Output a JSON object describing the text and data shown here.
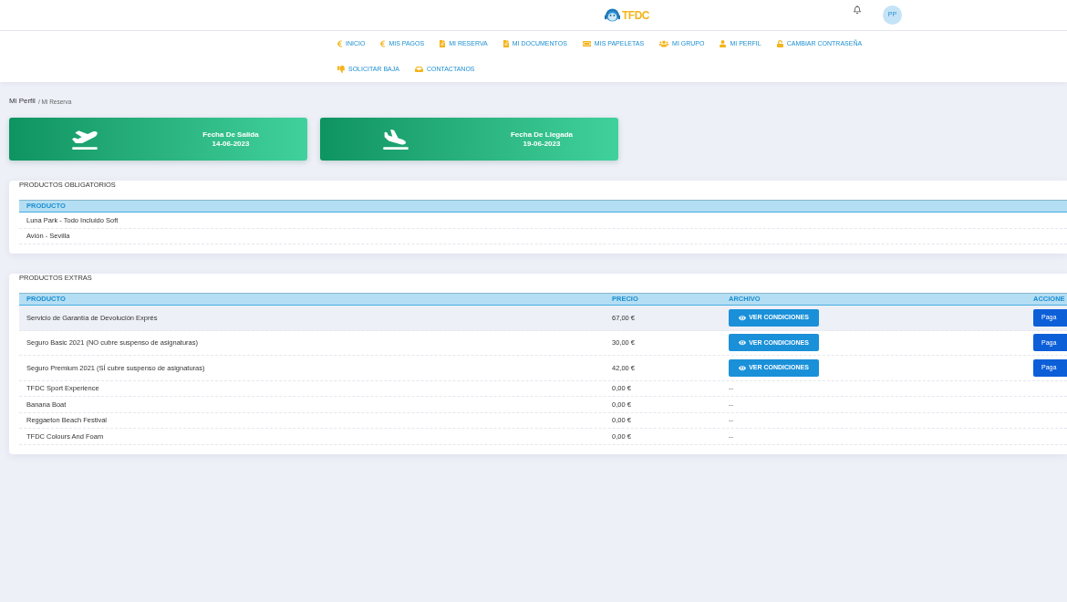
{
  "header": {
    "logo_text": "TFDC",
    "avatar_initials": "PP"
  },
  "nav": {
    "items": [
      {
        "label": "INICIO"
      },
      {
        "label": "MIS PAGOS"
      },
      {
        "label": "MI RESERVA"
      },
      {
        "label": "MI DOCUMENTOS"
      },
      {
        "label": "MIS PAPELETAS"
      },
      {
        "label": "MI GRUPO"
      },
      {
        "label": "MI PERFIL"
      },
      {
        "label": "CAMBIAR CONTRASEÑA"
      },
      {
        "label": "SOLICITAR BAJA"
      },
      {
        "label": "CONTACTANOS"
      }
    ]
  },
  "breadcrumb": {
    "parent": "Mi Perfil",
    "current": "/ Mi Reserva"
  },
  "date_cards": [
    {
      "kind": "departure",
      "label": "Fecha De Salida",
      "date": "14-06-2023"
    },
    {
      "kind": "arrival",
      "label": "Fecha De Llegada",
      "date": "19-06-2023"
    }
  ],
  "mandatory_products": {
    "title": "PRODUCTOS OBLIGATORIOS",
    "columns": [
      "PRODUCTO"
    ],
    "rows": [
      {
        "product": "Luna Park - Todo Incluido Soft"
      },
      {
        "product": "Avión - Sevilla"
      }
    ]
  },
  "extra_products": {
    "title": "PRODUCTOS EXTRAS",
    "columns": [
      "PRODUCTO",
      "PRECIO",
      "ARCHIVO",
      "ACCIONE"
    ],
    "rows": [
      {
        "product": "Servicio de Garantía de Devolución Exprés",
        "price": "67,00 €",
        "file": {
          "kind": "button",
          "label": "VER CONDICIONES"
        },
        "action": "Paga",
        "hovered": true
      },
      {
        "product": "Seguro Basic 2021 (NO cubre suspenso de asignaturas)",
        "price": "30,00 €",
        "file": {
          "kind": "button",
          "label": "VER CONDICIONES"
        },
        "action": "Paga",
        "hovered": false
      },
      {
        "product": "Seguro Premium 2021 (SÍ cubre suspenso de asignaturas)",
        "price": "42,00 €",
        "file": {
          "kind": "button",
          "label": "VER CONDICIONES"
        },
        "action": "Paga",
        "hovered": false
      },
      {
        "product": "TFDC Sport Experience",
        "price": "0,00 €",
        "file": {
          "kind": "text",
          "label": "--"
        },
        "hovered": false
      },
      {
        "product": "Banana Boat",
        "price": "0,00 €",
        "file": {
          "kind": "text",
          "label": "--"
        },
        "hovered": false
      },
      {
        "product": "Reggaeton Beach Festival",
        "price": "0,00 €",
        "file": {
          "kind": "text",
          "label": "--"
        },
        "hovered": false
      },
      {
        "product": "TFDC Colours And Foam",
        "price": "0,00 €",
        "file": {
          "kind": "text",
          "label": "--"
        },
        "hovered": false
      }
    ]
  }
}
